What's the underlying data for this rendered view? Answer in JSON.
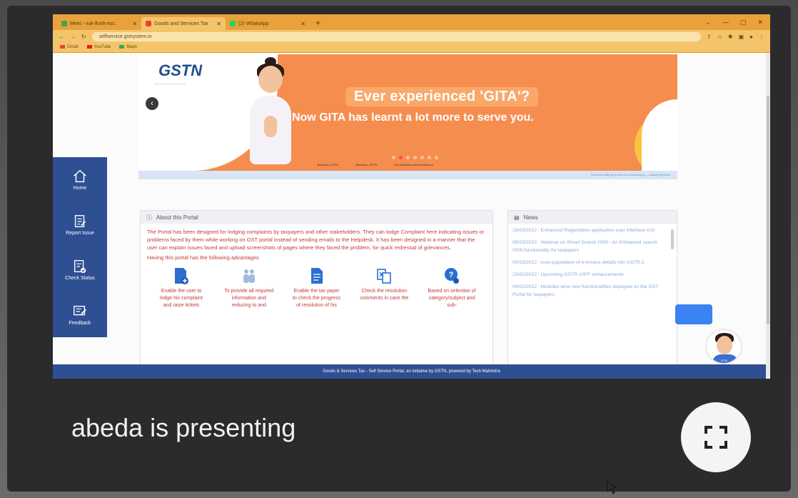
{
  "browser": {
    "tabs": [
      {
        "label": "Meet - vuk-fkmh-ezc",
        "color": "#34a853"
      },
      {
        "label": "Goods and Services Tax",
        "color": "#e94235"
      },
      {
        "label": "(2) WhatsApp",
        "color": "#25d366"
      }
    ],
    "url": "selfservice.gstsystem.in",
    "bookmarks": [
      "Gmail",
      "YouTube",
      "Maps"
    ]
  },
  "banner": {
    "headline": "Ever experienced 'GITA'?",
    "subline": "Now GITA has learnt a lot more to serve you.",
    "logo": "GSTN",
    "social": [
      "@Infosys_GSTN",
      "@Infosys_GSTN",
      "GoodsandServicesTaxNetwork"
    ],
    "strip_text": "Technical difficulty in access or functioning — contact helpdesk"
  },
  "rail": [
    {
      "label": "Home",
      "icon": "home-icon"
    },
    {
      "label": "Report Issue",
      "icon": "report-issue-icon"
    },
    {
      "label": "Check Status",
      "icon": "check-status-icon"
    },
    {
      "label": "Feedback",
      "icon": "feedback-icon"
    }
  ],
  "about": {
    "title": "About this Portal",
    "text": "The Portal has been designed for lodging complaints by taxpayers and other stakeholders. They can lodge Complaint here indicating issues or problems faced by them while working on GST portal instead of sending emails to the Helpdesk. It has been designed in a manner that the user can explain issues faced and upload screenshots of pages where they faced the problem, for quick redressal of grievances.",
    "advantages_intro": "Having this portal has the following advantages",
    "features": [
      {
        "text": "Enable the user to lodge his complaint and raise tickets",
        "icon": "ticket-icon",
        "color": "#2a6fcf"
      },
      {
        "text": "To provide all required information and reducing to and",
        "icon": "people-icon",
        "color": "#7aa6d8"
      },
      {
        "text": "Enable the tax payer to check the progress of resolution of his",
        "icon": "document-icon",
        "color": "#2a6fcf"
      },
      {
        "text": "Check the resolution comments in case the",
        "icon": "compare-icon",
        "color": "#2a6fcf"
      },
      {
        "text": "Based on selection of category/subject and sub-",
        "icon": "question-chat-icon",
        "color": "#2a6fcf"
      }
    ]
  },
  "news": {
    "title": "News",
    "items": [
      "15/03/2022 : Enhanced Registration application user interface (UI)",
      "08/03/2022 : Webinar on Smart Search HSN - An Enhanced search HSN functionality for taxpayers",
      "03/03/2022 : Auto-population of e-invoice details into GSTR-1",
      "23/02/2022 : Upcoming GSTR-1/IFF enhancements",
      "04/02/2022 : Modules wise new functionalities deployed on the GST Portal for taxpayers"
    ]
  },
  "footer": "Goods & Services Tax - Self Service Portal, an initiative by GSTN, powered by Tech Mahindra",
  "gita_label": "GITA",
  "meet": {
    "presenter_text": "abeda is presenting"
  }
}
